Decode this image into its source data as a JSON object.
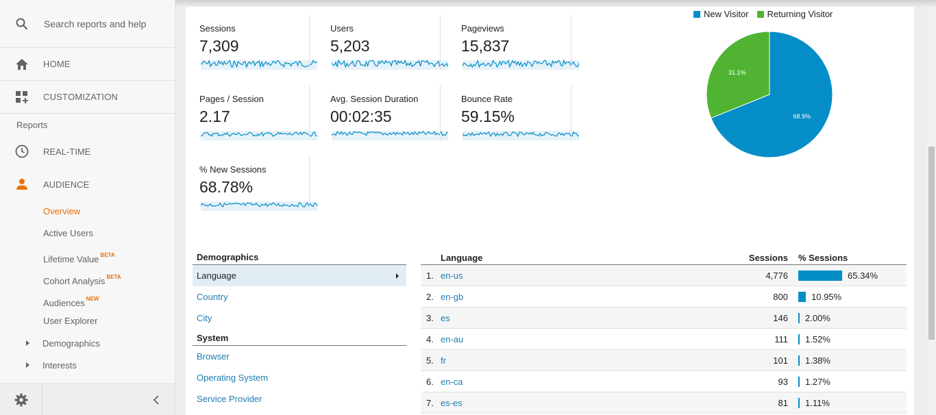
{
  "sidebar": {
    "search_placeholder": "Search reports and help",
    "home_label": "HOME",
    "customization_label": "CUSTOMIZATION",
    "reports_heading": "Reports",
    "realtime_label": "REAL-TIME",
    "audience_label": "AUDIENCE",
    "audience_items": {
      "overview": "Overview",
      "active_users": "Active Users",
      "lifetime_value": "Lifetime Value",
      "lifetime_value_badge": "BETA",
      "cohort_analysis": "Cohort Analysis",
      "cohort_analysis_badge": "BETA",
      "audiences": "Audiences",
      "audiences_badge": "NEW",
      "user_explorer": "User Explorer",
      "demographics": "Demographics",
      "interests": "Interests"
    }
  },
  "metrics": [
    {
      "name": "Sessions",
      "value": "7,309"
    },
    {
      "name": "Users",
      "value": "5,203"
    },
    {
      "name": "Pageviews",
      "value": "15,837"
    },
    {
      "name": "Pages / Session",
      "value": "2.17"
    },
    {
      "name": "Avg. Session Duration",
      "value": "00:02:35"
    },
    {
      "name": "Bounce Rate",
      "value": "59.15%"
    },
    {
      "name": "% New Sessions",
      "value": "68.78%"
    }
  ],
  "pie": {
    "legend": [
      "New Visitor",
      "Returning Visitor"
    ],
    "colors": [
      "#058dc7",
      "#50b432"
    ],
    "labels": [
      "68.9%",
      "31.1%"
    ]
  },
  "chart_data": {
    "type": "pie",
    "categories": [
      "New Visitor",
      "Returning Visitor"
    ],
    "values": [
      68.9,
      31.1
    ],
    "legend_position": "top"
  },
  "demographics_nav": {
    "demographics_heading": "Demographics",
    "language": "Language",
    "country": "Country",
    "city": "City",
    "system_heading": "System",
    "browser": "Browser",
    "operating_system": "Operating System",
    "service_provider": "Service Provider"
  },
  "language_table": {
    "headers": {
      "language": "Language",
      "sessions": "Sessions",
      "pct_sessions": "% Sessions"
    },
    "rows": [
      {
        "num": "1.",
        "lang": "en-us",
        "sessions": "4,776",
        "pct": "65.34%",
        "fraction": 0.6534
      },
      {
        "num": "2.",
        "lang": "en-gb",
        "sessions": "800",
        "pct": "10.95%",
        "fraction": 0.1095
      },
      {
        "num": "3.",
        "lang": "es",
        "sessions": "146",
        "pct": "2.00%",
        "fraction": 0.02
      },
      {
        "num": "4.",
        "lang": "en-au",
        "sessions": "111",
        "pct": "1.52%",
        "fraction": 0.0152
      },
      {
        "num": "5.",
        "lang": "fr",
        "sessions": "101",
        "pct": "1.38%",
        "fraction": 0.0138
      },
      {
        "num": "6.",
        "lang": "en-ca",
        "sessions": "93",
        "pct": "1.27%",
        "fraction": 0.0127
      },
      {
        "num": "7.",
        "lang": "es-es",
        "sessions": "81",
        "pct": "1.11%",
        "fraction": 0.0111
      }
    ]
  },
  "colors": {
    "accent_orange": "#e8710a",
    "link_blue": "#1e7db0",
    "bar_blue": "#058dc7",
    "pie_green": "#50b432"
  }
}
